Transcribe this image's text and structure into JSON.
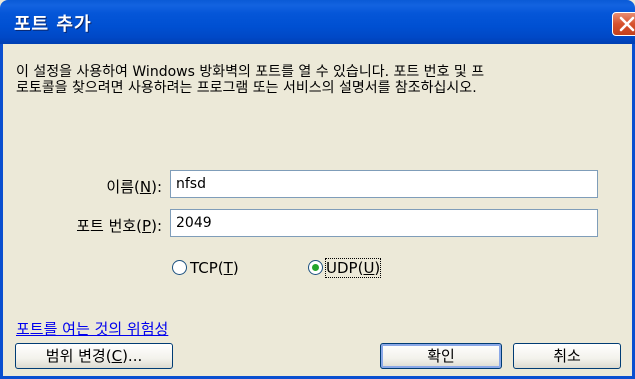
{
  "window": {
    "title": "포트 추가"
  },
  "description": "이 설정을 사용하여 Windows 방화벽의 포트를 열 수 있습니다. 포트 번호 및 프\n로토콜을 찾으려면 사용하려는 프로그램 또는 서비스의 설명서를 참조하십시오.",
  "fields": {
    "name": {
      "label_prefix": "이름(",
      "accel": "N",
      "label_suffix": "):",
      "value": "nfsd"
    },
    "port": {
      "label_prefix": "포트 번호(",
      "accel": "P",
      "label_suffix": "):",
      "value": "2049"
    }
  },
  "protocol": {
    "tcp": {
      "prefix": "TCP(",
      "accel": "T",
      "suffix": ")",
      "selected": false
    },
    "udp": {
      "prefix": "UDP(",
      "accel": "U",
      "suffix": ")",
      "selected": true
    }
  },
  "link_text": "포트를 여는 것의 위험성",
  "buttons": {
    "change_scope": {
      "prefix": "범위 변경(",
      "accel": "C",
      "suffix": ")..."
    },
    "ok": "확인",
    "cancel": "취소"
  },
  "icons": {
    "close": "close-icon"
  },
  "colors": {
    "titlebar": "#0054e3",
    "dialog_bg": "#ece9d8",
    "close_button": "#d7522e",
    "link": "#0000ee",
    "radio_dot": "#24a52b"
  }
}
